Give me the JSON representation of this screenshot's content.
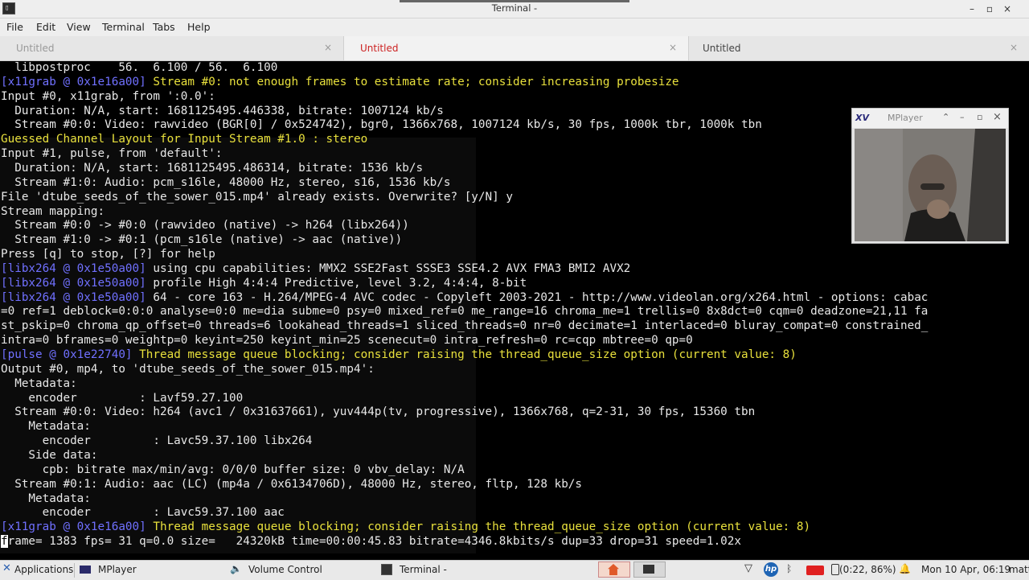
{
  "window": {
    "title": "Terminal -",
    "app_icon_glyph": "▯",
    "buttons": {
      "minimize": "–",
      "restore": "▫",
      "close": "×"
    }
  },
  "menu": [
    "File",
    "Edit",
    "View",
    "Terminal",
    "Tabs",
    "Help"
  ],
  "tabs": [
    {
      "label": "Untitled",
      "close": "×"
    },
    {
      "label": "Untitled",
      "close": "×"
    },
    {
      "label": "Untitled",
      "close": "×"
    }
  ],
  "colors": {
    "prefix": "#7070ff",
    "highlight": "#e8e03c",
    "active_tab": "#cc2222"
  },
  "terminal": {
    "lines": [
      [
        {
          "t": "  libpostproc    56.  6.100 / 56.  6.100"
        }
      ],
      [
        {
          "t": "[x11grab @ 0x1e16a00]",
          "c": "pre"
        },
        {
          "t": " Stream #0: not enough frames to estimate rate; consider increasing probesize",
          "c": "yel"
        }
      ],
      [
        {
          "t": "Input #0, x11grab, from ':0.0':"
        }
      ],
      [
        {
          "t": "  Duration: N/A, start: 1681125495.446338, bitrate: 1007124 kb/s"
        }
      ],
      [
        {
          "t": "  Stream #0:0: Video: rawvideo (BGR[0] / 0x524742), bgr0, 1366x768, 1007124 kb/s, 30 fps, 1000k tbr, 1000k tbn"
        }
      ],
      [
        {
          "t": "Guessed Channel Layout for Input Stream #1.0 : stereo",
          "c": "yel"
        }
      ],
      [
        {
          "t": "Input #1, pulse, from 'default':"
        }
      ],
      [
        {
          "t": "  Duration: N/A, start: 1681125495.486314, bitrate: 1536 kb/s"
        }
      ],
      [
        {
          "t": "  Stream #1:0: Audio: pcm_s16le, 48000 Hz, stereo, s16, 1536 kb/s"
        }
      ],
      [
        {
          "t": "File 'dtube_seeds_of_the_sower_015.mp4' already exists. Overwrite? [y/N] y"
        }
      ],
      [
        {
          "t": "Stream mapping:"
        }
      ],
      [
        {
          "t": "  Stream #0:0 -> #0:0 (rawvideo (native) -> h264 (libx264))"
        }
      ],
      [
        {
          "t": "  Stream #1:0 -> #0:1 (pcm_s16le (native) -> aac (native))"
        }
      ],
      [
        {
          "t": "Press [q] to stop, [?] for help"
        }
      ],
      [
        {
          "t": "[libx264 @ 0x1e50a00]",
          "c": "pre"
        },
        {
          "t": " using cpu capabilities: MMX2 SSE2Fast SSSE3 SSE4.2 AVX FMA3 BMI2 AVX2"
        }
      ],
      [
        {
          "t": "[libx264 @ 0x1e50a00]",
          "c": "pre"
        },
        {
          "t": " profile High 4:4:4 Predictive, level 3.2, 4:4:4, 8-bit"
        }
      ],
      [
        {
          "t": "[libx264 @ 0x1e50a00]",
          "c": "pre"
        },
        {
          "t": " 64 - core 163 - H.264/MPEG-4 AVC codec - Copyleft 2003-2021 - http://www.videolan.org/x264.html - options: cabac"
        }
      ],
      [
        {
          "t": "=0 ref=1 deblock=0:0:0 analyse=0:0 me=dia subme=0 psy=0 mixed_ref=0 me_range=16 chroma_me=1 trellis=0 8x8dct=0 cqm=0 deadzone=21,11 fa"
        }
      ],
      [
        {
          "t": "st_pskip=0 chroma_qp_offset=0 threads=6 lookahead_threads=1 sliced_threads=0 nr=0 decimate=1 interlaced=0 bluray_compat=0 constrained_"
        }
      ],
      [
        {
          "t": "intra=0 bframes=0 weightp=0 keyint=250 keyint_min=25 scenecut=0 intra_refresh=0 rc=cqp mbtree=0 qp=0"
        }
      ],
      [
        {
          "t": "[pulse @ 0x1e22740]",
          "c": "pre"
        },
        {
          "t": " Thread message queue blocking; consider raising the thread_queue_size option (current value: 8)",
          "c": "yel"
        }
      ],
      [
        {
          "t": "Output #0, mp4, to 'dtube_seeds_of_the_sower_015.mp4':"
        }
      ],
      [
        {
          "t": "  Metadata:"
        }
      ],
      [
        {
          "t": "    encoder         : Lavf59.27.100"
        }
      ],
      [
        {
          "t": "  Stream #0:0: Video: h264 (avc1 / 0x31637661), yuv444p(tv, progressive), 1366x768, q=2-31, 30 fps, 15360 tbn"
        }
      ],
      [
        {
          "t": "    Metadata:"
        }
      ],
      [
        {
          "t": "      encoder         : Lavc59.37.100 libx264"
        }
      ],
      [
        {
          "t": "    Side data:"
        }
      ],
      [
        {
          "t": "      cpb: bitrate max/min/avg: 0/0/0 buffer size: 0 vbv_delay: N/A"
        }
      ],
      [
        {
          "t": "  Stream #0:1: Audio: aac (LC) (mp4a / 0x6134706D), 48000 Hz, stereo, fltp, 128 kb/s"
        }
      ],
      [
        {
          "t": "    Metadata:"
        }
      ],
      [
        {
          "t": "      encoder         : Lavc59.37.100 aac"
        }
      ],
      [
        {
          "t": "[x11grab @ 0x1e16a00]",
          "c": "pre"
        },
        {
          "t": " Thread message queue blocking; consider raising the thread_queue_size option (current value: 8)",
          "c": "yel"
        }
      ],
      [
        {
          "t": "f",
          "c": "cursor"
        },
        {
          "t": "rame= 1383 fps= 31 q=0.0 size=   24320kB time=00:00:45.83 bitrate=4346.8kbits/s dup=33 drop=31 speed=1.02x"
        }
      ]
    ]
  },
  "mplayer": {
    "badge": "XV",
    "title": "MPlayer",
    "buttons": {
      "shade": "⌃",
      "minimize": "–",
      "maximize": "▫",
      "close": "×"
    }
  },
  "taskbar": {
    "applications": "Applications",
    "tasks": [
      "MPlayer",
      "Volume Control",
      "Terminal -"
    ],
    "battery": "(0:22, 86%)",
    "clock": "Mon 10 Apr, 06:19",
    "user": "matt"
  }
}
